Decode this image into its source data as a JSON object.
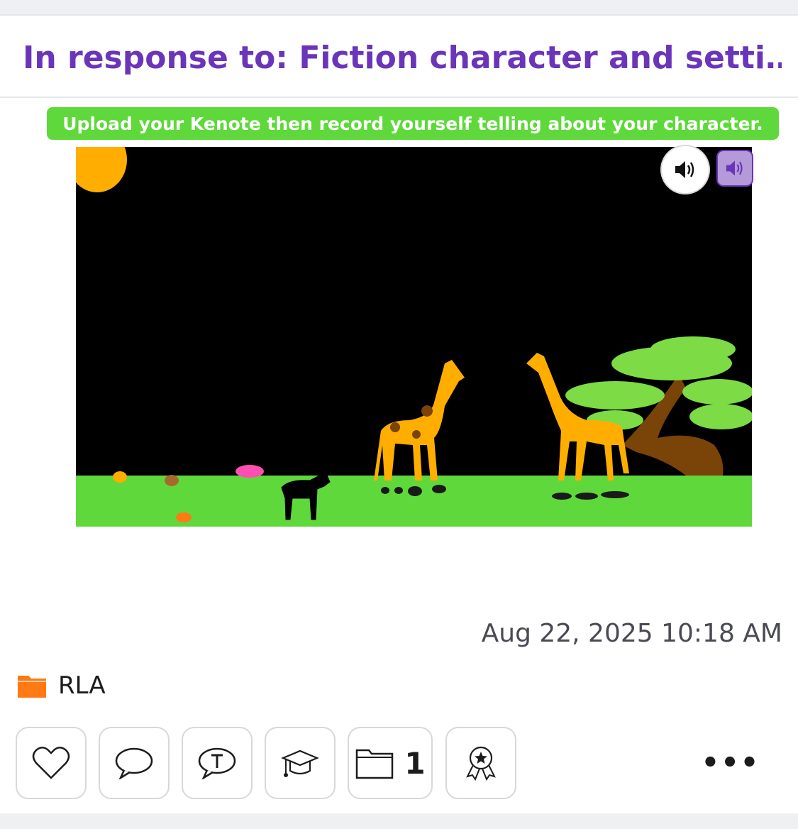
{
  "post": {
    "title": "In response to: Fiction character and setti…",
    "prompt_text": "Upload your Kenote then record yourself telling about your character.",
    "timestamp": "Aug 22, 2025 10:18 AM"
  },
  "media": {
    "audio_button_icon": "speaker-icon",
    "audio_toggle_icon": "speaker-icon"
  },
  "folder": {
    "icon": "folder-icon",
    "label": "RLA",
    "color": "#ff7a14"
  },
  "actions": [
    {
      "name": "like-button",
      "icon": "heart-icon"
    },
    {
      "name": "comment-button",
      "icon": "speech-bubble-icon"
    },
    {
      "name": "teacher-comment-button",
      "icon": "teacher-comment-icon"
    },
    {
      "name": "skills-button",
      "icon": "graduation-cap-icon"
    },
    {
      "name": "folders-button",
      "icon": "folder-icon",
      "count": "1"
    },
    {
      "name": "badge-button",
      "icon": "award-icon"
    }
  ],
  "more_label": "•••",
  "colors": {
    "title": "#6a35b8",
    "prompt_bg": "#5fd83b",
    "grass": "#5fd83b",
    "giraffe": "#ffae00",
    "tree_leaves": "#7ddb45",
    "trunk": "#7a4308"
  }
}
